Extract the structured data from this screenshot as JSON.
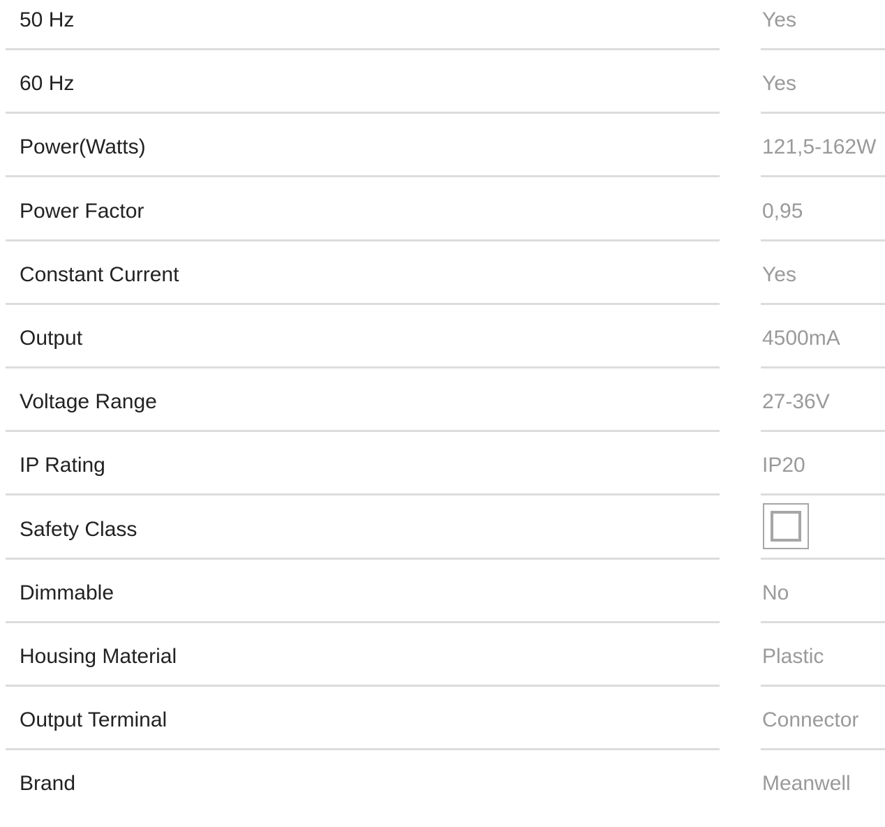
{
  "specs": [
    {
      "label": "50 Hz",
      "value": "Yes"
    },
    {
      "label": "60 Hz",
      "value": "Yes"
    },
    {
      "label": "Power(Watts)",
      "value": "121,5-162W"
    },
    {
      "label": "Power Factor",
      "value": "0,95"
    },
    {
      "label": "Constant Current",
      "value": "Yes"
    },
    {
      "label": "Output",
      "value": "4500mA"
    },
    {
      "label": "Voltage Range",
      "value": "27-36V"
    },
    {
      "label": "IP Rating",
      "value": "IP20"
    },
    {
      "label": "Safety Class",
      "value_icon": "class-ii-double-square-icon"
    },
    {
      "label": "Dimmable",
      "value": "No"
    },
    {
      "label": "Housing Material",
      "value": "Plastic"
    },
    {
      "label": "Output Terminal",
      "value": "Connector"
    },
    {
      "label": "Brand",
      "value": "Meanwell"
    }
  ],
  "colors": {
    "label_text": "#222222",
    "value_text": "#9a9a9a",
    "divider": "#dcdcdc",
    "icon_stroke": "#a6a6a6"
  }
}
